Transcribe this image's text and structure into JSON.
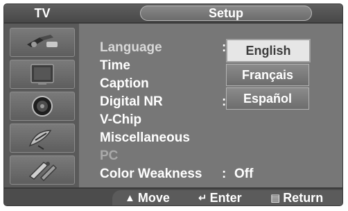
{
  "header": {
    "tv_label": "TV",
    "title": "Setup"
  },
  "menu": {
    "items": [
      {
        "label": "Language",
        "value": "",
        "state": "active"
      },
      {
        "label": "Time",
        "value": ""
      },
      {
        "label": "Caption",
        "value": ""
      },
      {
        "label": "Digital NR",
        "value": ""
      },
      {
        "label": "V-Chip",
        "value": ""
      },
      {
        "label": "Miscellaneous",
        "value": ""
      },
      {
        "label": "PC",
        "value": "",
        "state": "disabled"
      },
      {
        "label": "Color Weakness",
        "value": "Off"
      }
    ],
    "colon": ":"
  },
  "dropdown": {
    "options": [
      "English",
      "Français",
      "Español"
    ],
    "selected": "English"
  },
  "footer": {
    "move": "Move",
    "enter": "Enter",
    "return": "Return"
  },
  "icons": [
    "input-connector-icon",
    "tv-screen-icon",
    "speaker-icon",
    "satellite-dish-icon",
    "setup-tools-icon"
  ],
  "colors": {
    "panel": "#6b6b6b",
    "menu_bg": "#777777",
    "selected_bg": "#e6e6e6",
    "text": "#ffffff",
    "disabled_text": "#a9a9a9"
  }
}
